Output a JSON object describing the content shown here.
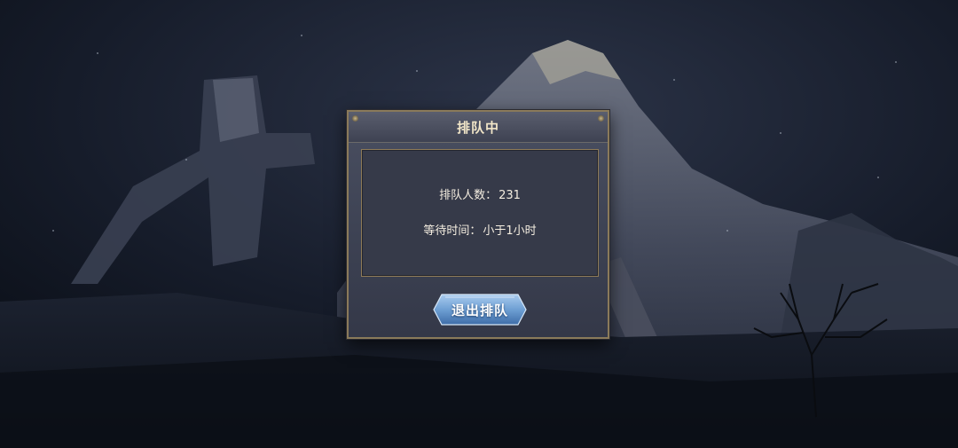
{
  "dialog": {
    "title": "排队中",
    "queue_label": "排队人数：",
    "queue_count": "231",
    "wait_label": "等待时间：",
    "wait_value": "小于1小时",
    "exit_button_label": "退出排队"
  },
  "colors": {
    "dialog_border": "#8a7a5a",
    "title_text": "#f2e6c8",
    "button_blue": "#6e9fd3"
  },
  "icons": [
    "snowy-mountain-background",
    "ruined-tower-background",
    "dead-tree-background"
  ]
}
